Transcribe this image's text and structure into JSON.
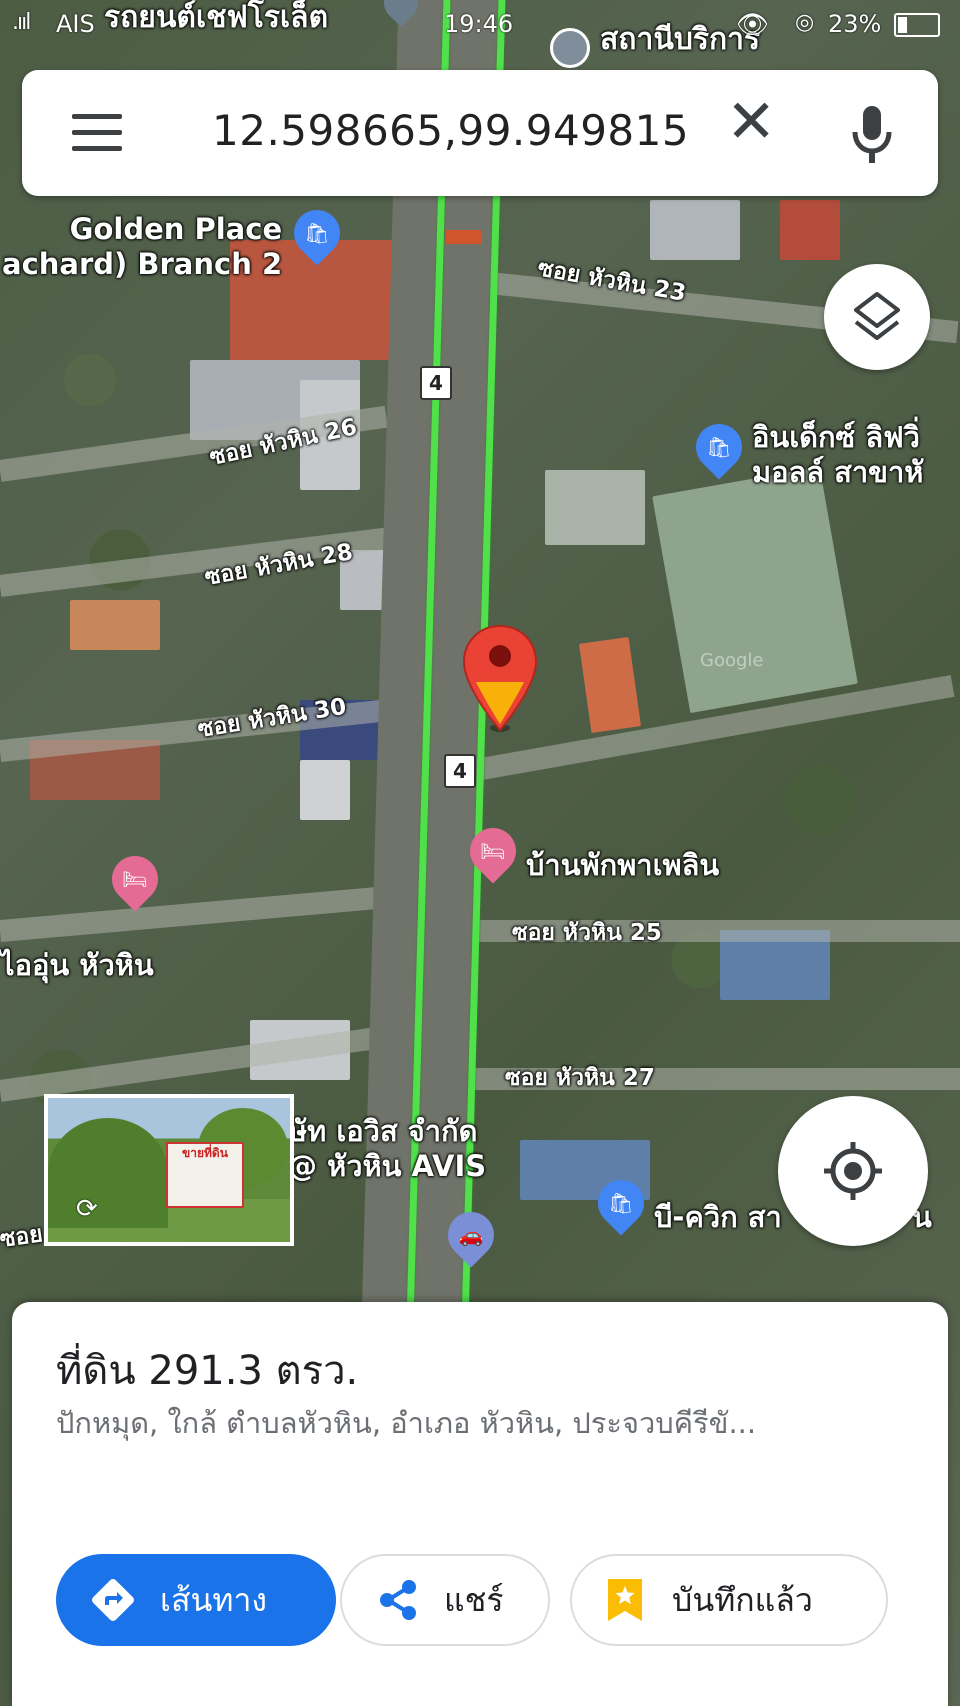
{
  "status_bar": {
    "carrier": "AIS",
    "time": "19:46",
    "battery": "23%"
  },
  "search": {
    "query": "12.598665,99.949815",
    "menu_icon": "menu-icon",
    "clear_icon": "close-icon",
    "mic_icon": "mic-icon"
  },
  "map": {
    "places": {
      "top_center": "รถยนต์เชฟโรเล็ต",
      "top_right": "สถานีบริการ",
      "golden_place_1": "Golden Place",
      "golden_place_2": "achard) Branch 2",
      "index_1": "อินเด็กซ์ ลิฟวิ่",
      "index_2": "มอลล์ สาขาหั",
      "hotel_right": "บ้านพักพาเพลิน",
      "hotel_left": "ไออุ่น หัวหิน",
      "avis_1": "ษัท เอวิส จำกัด",
      "avis_2": "@ หัวหิน AVIS",
      "bquik": "บี-ควิก สา",
      "bquik_tail": "น"
    },
    "roads": {
      "soi23": "ซอย หัวหิน 23",
      "soi26": "ซอย หัวหิน 26",
      "soi28": "ซอย หัวหิน 28",
      "soi30": "ซอย หัวหิน 30",
      "soi25": "ซอย หัวหิน 25",
      "soi27": "ซอย หัวหิน 27",
      "soi_left": "ซอย"
    },
    "route_shield": "4",
    "watermark": "Google"
  },
  "street_view": {
    "sign_text": "ขายที่ดิน",
    "rotate_icon": "rotate-360-icon"
  },
  "place": {
    "title": "ที่ดิน 291.3 ตรว.",
    "subtitle": "ปักหมุด, ใกล้ ตำบลหัวหิน, อำเภอ หัวหิน, ประจวบคีรีขั..."
  },
  "actions": {
    "directions": "เส้นทาง",
    "share": "แชร์",
    "saved": "บันทึกแล้ว"
  },
  "colors": {
    "accent": "#1a73e8",
    "pin": "#ea4335",
    "highway": "#4fe04a",
    "hotel_pin": "#e46b93",
    "shop_pin": "#4285f4"
  }
}
